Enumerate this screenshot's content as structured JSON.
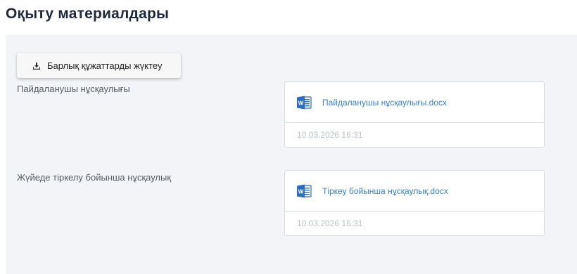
{
  "page": {
    "title": "Оқыту материалдары"
  },
  "toolbar": {
    "download_all_label": "Барлық құжаттарды жүктеу",
    "download_icon": "download-icon"
  },
  "materials": [
    {
      "label": "Пайдаланушы нұсқаулығы",
      "file_name": "Пайдаланушы нұсқаулығы.docx",
      "date": "10.03.2026 16:31",
      "file_icon": "word-document-icon"
    },
    {
      "label": "Жүйеде тіркелу бойынша нұсқаулық",
      "file_name": "Тіркеу бойынша нұсқаулық.docx",
      "date": "10.03.2026 16:31",
      "file_icon": "word-document-icon"
    }
  ],
  "colors": {
    "link": "#3b82c4",
    "word_blue": "#2b6cc4",
    "panel_bg": "#f3f4f7"
  }
}
